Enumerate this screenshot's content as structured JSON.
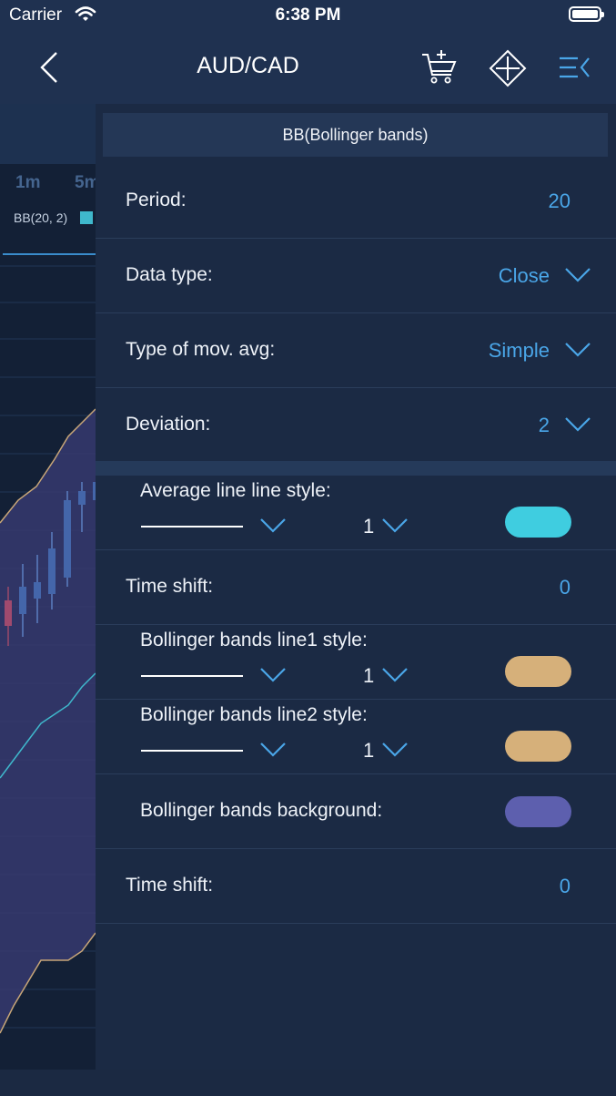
{
  "status": {
    "carrier": "Carrier",
    "time": "6:38 PM"
  },
  "nav": {
    "title": "AUD/CAD"
  },
  "chart": {
    "timeframes": [
      "1m",
      "5m"
    ],
    "indicator_label": "BB(20, 2)",
    "indicator_color": "#3fb8cc"
  },
  "panel": {
    "title": "BB(Bollinger bands)",
    "period": {
      "label": "Period:",
      "value": "20"
    },
    "data_type": {
      "label": "Data type:",
      "value": "Close"
    },
    "mov_avg": {
      "label": "Type of mov. avg:",
      "value": "Simple"
    },
    "deviation": {
      "label": "Deviation:",
      "value": "2"
    },
    "average_line": {
      "label": "Average line line style:",
      "width": "1",
      "color": "#3fcde0"
    },
    "time_shift_1": {
      "label": "Time shift:",
      "value": "0"
    },
    "bb_line1": {
      "label": "Bollinger bands line1 style:",
      "width": "1",
      "color": "#d6b07a"
    },
    "bb_line2": {
      "label": "Bollinger bands line2 style:",
      "width": "1",
      "color": "#d6b07a"
    },
    "bb_background": {
      "label": "Bollinger bands background:",
      "color": "#5d5fae"
    },
    "time_shift_2": {
      "label": "Time shift:",
      "value": "0"
    }
  },
  "colors": {
    "accent": "#4aa6e8",
    "background": "#1b2a44"
  }
}
